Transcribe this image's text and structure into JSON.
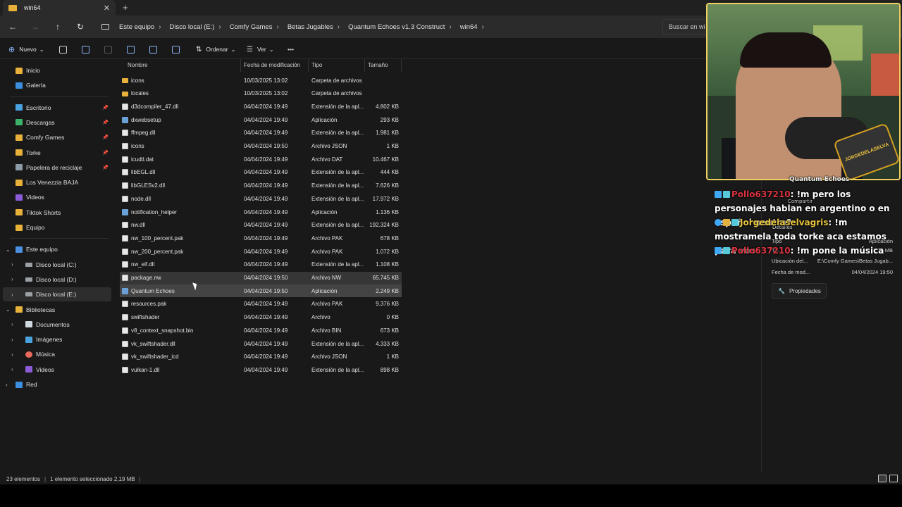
{
  "window": {
    "tab_title": "win64",
    "tab_close": "✕",
    "new_tab": "+"
  },
  "nav": {
    "back": "←",
    "forward": "→",
    "up": "↑",
    "refresh": "↻",
    "breadcrumbs": [
      "Este equipo",
      "Disco local (E:)",
      "Comfy Games",
      "Betas Jugables",
      "Quantum Echoes v1.3 Construct",
      "win64"
    ],
    "separator": "›",
    "search_placeholder": "Buscar en wi"
  },
  "toolbar": {
    "new_label": "Nuevo",
    "sort_label": "Ordenar",
    "view_label": "Ver",
    "more": "•••",
    "caret": "⌄"
  },
  "sidebar": {
    "quick": [
      {
        "label": "Inicio",
        "icon": "home-icon"
      },
      {
        "label": "Galería",
        "icon": "gallery-icon"
      }
    ],
    "pinned": [
      {
        "label": "Escritorio",
        "icon": "desktop-icon",
        "pinned": true
      },
      {
        "label": "Descargas",
        "icon": "downloads-icon",
        "pinned": true
      },
      {
        "label": "Comfy Games",
        "icon": "folder-icon",
        "pinned": true
      },
      {
        "label": "Torke",
        "icon": "folder-icon",
        "pinned": true
      },
      {
        "label": "Papelera de reciclaje",
        "icon": "recycle-bin-icon",
        "pinned": true
      },
      {
        "label": "Los Venezzia BAJA",
        "icon": "folder-icon",
        "pinned": false
      },
      {
        "label": "Videos",
        "icon": "videos-icon",
        "pinned": false
      },
      {
        "label": "Tiktok Shorts",
        "icon": "folder-icon",
        "pinned": false
      },
      {
        "label": "Equipo",
        "icon": "folder-icon",
        "pinned": false
      }
    ],
    "pc": [
      {
        "label": "Este equipo",
        "icon": "computer-icon",
        "expanded": true,
        "level": 0
      },
      {
        "label": "Disco local (C:)",
        "icon": "drive-icon",
        "level": 1
      },
      {
        "label": "Disco local (D:)",
        "icon": "drive-icon",
        "level": 1
      },
      {
        "label": "Disco local (E:)",
        "icon": "drive-icon",
        "level": 1,
        "selected": true
      },
      {
        "label": "Bibliotecas",
        "icon": "libraries-icon",
        "expanded": true,
        "level": 0
      },
      {
        "label": "Documentos",
        "icon": "documents-icon",
        "level": 1
      },
      {
        "label": "Imágenes",
        "icon": "pictures-icon",
        "level": 1
      },
      {
        "label": "Música",
        "icon": "music-icon",
        "level": 1
      },
      {
        "label": "Videos",
        "icon": "videos-icon",
        "level": 1
      },
      {
        "label": "Red",
        "icon": "network-icon",
        "level": 0
      }
    ],
    "pin_glyph": "📌",
    "chev_open": "⌄",
    "chev_closed": "›"
  },
  "columns": {
    "name": "Nombre",
    "date": "Fecha de modificación",
    "type": "Tipo",
    "size": "Tamaño"
  },
  "files": [
    {
      "name": "icons",
      "date": "10/03/2025 13:02",
      "type": "Carpeta de archivos",
      "size": "",
      "kind": "folder"
    },
    {
      "name": "locales",
      "date": "10/03/2025 13:02",
      "type": "Carpeta de archivos",
      "size": "",
      "kind": "folder"
    },
    {
      "name": "d3dcompiler_47.dll",
      "date": "04/04/2024 19:49",
      "type": "Extensión de la apl...",
      "size": "4.802 KB",
      "kind": "file"
    },
    {
      "name": "dxwebsetup",
      "date": "04/04/2024 19:49",
      "type": "Aplicación",
      "size": "293 KB",
      "kind": "app"
    },
    {
      "name": "ffmpeg.dll",
      "date": "04/04/2024 19:49",
      "type": "Extensión de la apl...",
      "size": "1.981 KB",
      "kind": "file"
    },
    {
      "name": "icons",
      "date": "04/04/2024 19:50",
      "type": "Archivo JSON",
      "size": "1 KB",
      "kind": "file"
    },
    {
      "name": "icudtl.dat",
      "date": "04/04/2024 19:49",
      "type": "Archivo DAT",
      "size": "10.467 KB",
      "kind": "file"
    },
    {
      "name": "libEGL.dll",
      "date": "04/04/2024 19:49",
      "type": "Extensión de la apl...",
      "size": "444 KB",
      "kind": "file"
    },
    {
      "name": "libGLESv2.dll",
      "date": "04/04/2024 19:49",
      "type": "Extensión de la apl...",
      "size": "7.626 KB",
      "kind": "file"
    },
    {
      "name": "node.dll",
      "date": "04/04/2024 19:49",
      "type": "Extensión de la apl...",
      "size": "17.972 KB",
      "kind": "file"
    },
    {
      "name": "notification_helper",
      "date": "04/04/2024 19:49",
      "type": "Aplicación",
      "size": "1.136 KB",
      "kind": "app"
    },
    {
      "name": "nw.dll",
      "date": "04/04/2024 19:49",
      "type": "Extensión de la apl...",
      "size": "192.324 KB",
      "kind": "file"
    },
    {
      "name": "nw_100_percent.pak",
      "date": "04/04/2024 19:49",
      "type": "Archivo PAK",
      "size": "678 KB",
      "kind": "file"
    },
    {
      "name": "nw_200_percent.pak",
      "date": "04/04/2024 19:49",
      "type": "Archivo PAK",
      "size": "1.072 KB",
      "kind": "file"
    },
    {
      "name": "nw_elf.dll",
      "date": "04/04/2024 19:49",
      "type": "Extensión de la apl...",
      "size": "1.108 KB",
      "kind": "file"
    },
    {
      "name": "package.nw",
      "date": "04/04/2024 19:50",
      "type": "Archivo NW",
      "size": "65.745 KB",
      "kind": "file",
      "hover": true
    },
    {
      "name": "Quantum Echoes",
      "date": "04/04/2024 19:50",
      "type": "Aplicación",
      "size": "2.249 KB",
      "kind": "app",
      "selected": true
    },
    {
      "name": "resources.pak",
      "date": "04/04/2024 19:49",
      "type": "Archivo PAK",
      "size": "9.376 KB",
      "kind": "file"
    },
    {
      "name": "swiftshader",
      "date": "04/04/2024 19:49",
      "type": "Archivo",
      "size": "0 KB",
      "kind": "file"
    },
    {
      "name": "v8_context_snapshot.bin",
      "date": "04/04/2024 19:49",
      "type": "Archivo BIN",
      "size": "673 KB",
      "kind": "file"
    },
    {
      "name": "vk_swiftshader.dll",
      "date": "04/04/2024 19:49",
      "type": "Extensión de la apl...",
      "size": "4.333 KB",
      "kind": "file"
    },
    {
      "name": "vk_swiftshader_icd",
      "date": "04/04/2024 19:49",
      "type": "Archivo JSON",
      "size": "1 KB",
      "kind": "file"
    },
    {
      "name": "vulkan-1.dll",
      "date": "04/04/2024 19:49",
      "type": "Extensión de la apl...",
      "size": "898 KB",
      "kind": "file"
    }
  ],
  "details": {
    "title": "Quantum Echoes",
    "share": "Compartir",
    "section": "Detalles",
    "rows": [
      {
        "k": "Tipo",
        "v": "Aplicación"
      },
      {
        "k": "Ta...",
        "v": "2,19 MB"
      },
      {
        "k": "Ubicación del...",
        "v": "E:\\Comfy Games\\Betas Jugab..."
      },
      {
        "k": "Fecha de mod...",
        "v": "04/04/2024 19:50"
      }
    ],
    "properties": "Propiedades"
  },
  "chat": [
    {
      "user": "Pollo637210",
      "color": "red",
      "text": ": !m pero los personajes hablan en argentino o en español neutro?"
    },
    {
      "user": "Jorgedelaselvagris",
      "color": "gold",
      "text": ": !m mostramela toda torke aca estamos para vos"
    },
    {
      "user": "Pollo637210",
      "color": "red",
      "text": ": !m pone la música"
    }
  ],
  "webcam": {
    "logo_text": "JORGEDELASELVA"
  },
  "status": {
    "count": "23 elementos",
    "selection": "1 elemento seleccionado  2,19 MB",
    "bar": "|"
  }
}
